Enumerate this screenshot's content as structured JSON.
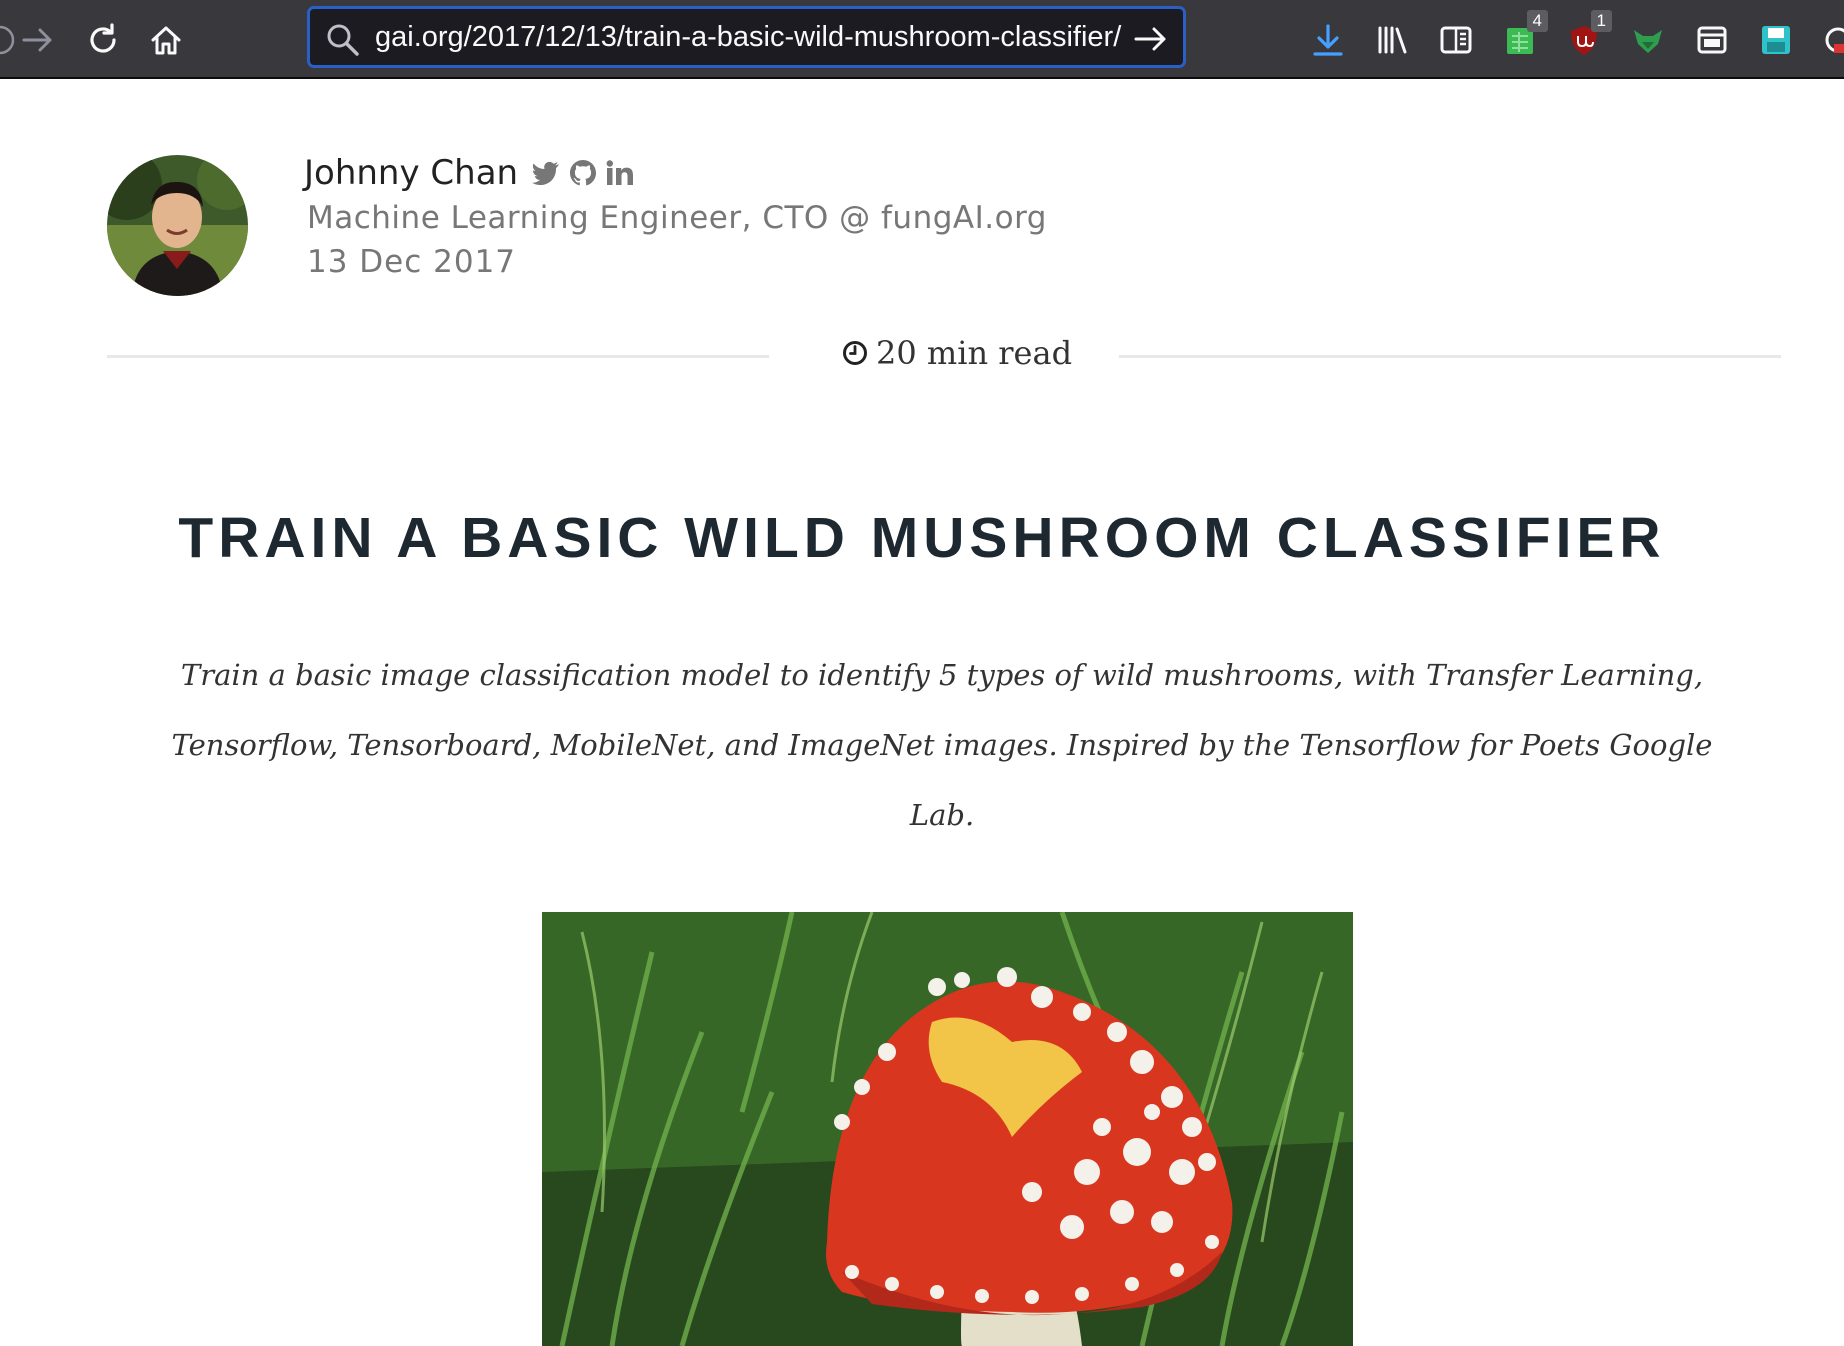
{
  "browser": {
    "url": "gai.org/2017/12/13/train-a-basic-wild-mushroom-classifier/",
    "extensions": [
      {
        "icon": "sheets-extension-icon",
        "badge": "4"
      },
      {
        "icon": "ublock-extension-icon",
        "badge": "1"
      }
    ]
  },
  "author": {
    "name": "Johnny Chan",
    "role": "Machine Learning Engineer, CTO @ fungAI.org",
    "date": "13 Dec 2017"
  },
  "post": {
    "read_time": "20 min read",
    "title": "TRAIN A BASIC WILD MUSHROOM CLASSIFIER",
    "subtitle": "Train a basic image classification model to identify 5 types of wild mushrooms, with Transfer Learning, Tensorflow, Tensorboard, MobileNet, and ImageNet images. Inspired by the Tensorflow for Poets Google Lab."
  },
  "colors": {
    "toolbar": "#38383d",
    "url_focus": "#2a5fc6",
    "title": "#1d2830",
    "muted": "#777777"
  }
}
